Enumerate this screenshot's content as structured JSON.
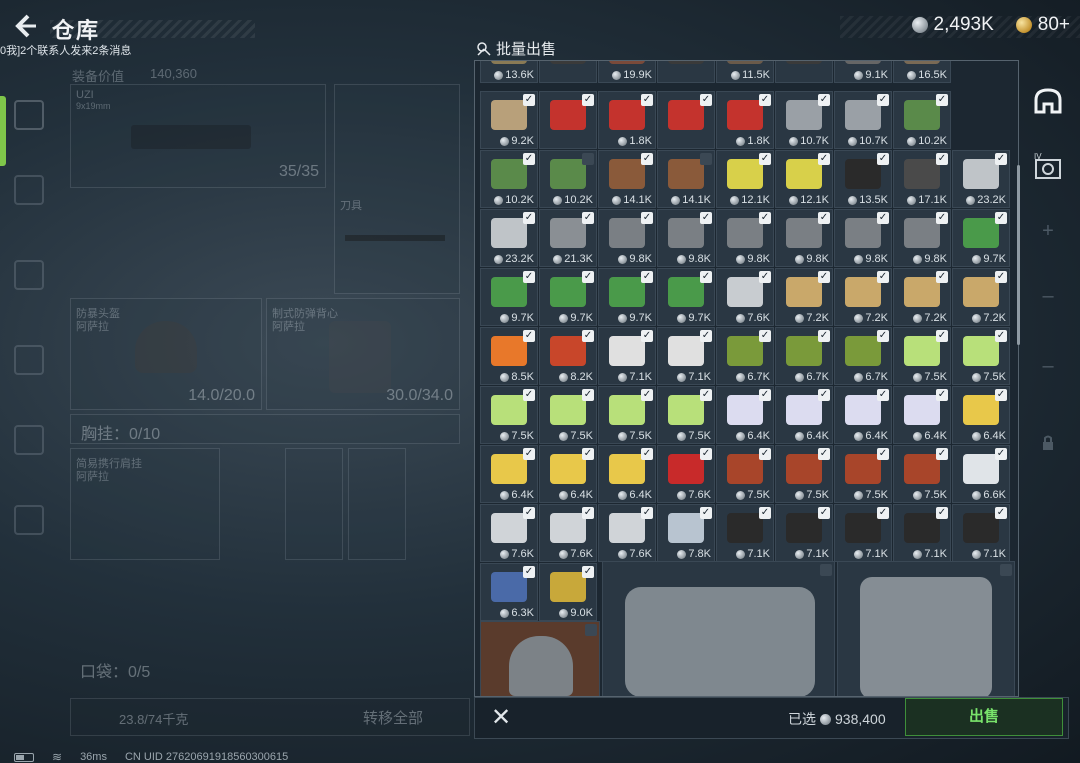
{
  "header": {
    "title": "仓库",
    "notice": "0我]2个联系人发来2条消息",
    "silver": "2,493K",
    "gold": "80+"
  },
  "loadout": {
    "equip_value_label": "装备价值",
    "equip_value": "140,360",
    "weapon_name": "UZI",
    "weapon_sub": "9x19mm",
    "weapon_ammo": "35/35",
    "melee_label": "刀具",
    "helmet_label": "防暴头盔",
    "helmet_sub": "阿萨拉",
    "helmet_durability": "14.0/20.0",
    "armor_label": "制式防弹背心",
    "armor_sub": "阿萨拉",
    "armor_durability": "30.0/34.0",
    "chest_rig": "胸挂：0/10",
    "backpack_label": "简易携行肩挂",
    "backpack_sub": "阿萨拉",
    "pouch": "口袋：0/5",
    "capacity": "23.8/74千克",
    "transfer_all": "转移全部"
  },
  "sale": {
    "title": "批量出售",
    "selected_label": "已选",
    "selected_value": "938,400",
    "sell_button": "出售"
  },
  "status": {
    "ping": "36ms",
    "uid": "CN UID 27620691918560300615"
  },
  "grid_rows": [
    {
      "prices": [
        "13.6K",
        "",
        "19.9K",
        "",
        "11.5K",
        "",
        "9.1K",
        "16.5K"
      ],
      "colors": [
        "#8a7a55",
        "#3a3a3a",
        "#7a4a3a",
        "#3a3a3a",
        "#6a5a4a",
        "#3a3a3a",
        "#666",
        "#7a6a55"
      ],
      "checks": [
        1,
        1,
        1,
        1,
        1,
        1,
        1,
        1
      ]
    },
    {
      "prices": [
        "9.2K",
        "",
        "1.8K",
        "",
        "1.8K",
        "10.7K",
        "10.7K",
        "10.2K"
      ],
      "colors": [
        "#b8a07a",
        "#c4332d",
        "#c4332d",
        "#c4332d",
        "#c4332d",
        "#9aa0a6",
        "#9aa0a6",
        "#5a8a4a"
      ],
      "checks": [
        1,
        1,
        1,
        1,
        1,
        1,
        1,
        1
      ]
    },
    {
      "prices": [
        "10.2K",
        "10.2K",
        "14.1K",
        "14.1K",
        "12.1K",
        "12.1K",
        "13.5K",
        "17.1K",
        "23.2K"
      ],
      "colors": [
        "#5a8a4a",
        "#5a8a4a",
        "#8a5a3a",
        "#8a5a3a",
        "#d8d04a",
        "#d8d04a",
        "#2a2a2a",
        "#4a4a4a",
        "#bfc4c8"
      ],
      "checks": [
        1,
        0,
        1,
        0,
        1,
        1,
        1,
        1,
        1
      ]
    },
    {
      "prices": [
        "23.2K",
        "21.3K",
        "9.8K",
        "9.8K",
        "9.8K",
        "9.8K",
        "9.8K",
        "9.8K",
        "9.7K"
      ],
      "colors": [
        "#bfc4c8",
        "#8a8f94",
        "#7a7f84",
        "#7a7f84",
        "#7a7f84",
        "#7a7f84",
        "#7a7f84",
        "#7a7f84",
        "#4a9a4a"
      ],
      "checks": [
        1,
        1,
        1,
        1,
        1,
        1,
        1,
        1,
        1
      ]
    },
    {
      "prices": [
        "9.7K",
        "9.7K",
        "9.7K",
        "9.7K",
        "7.6K",
        "7.2K",
        "7.2K",
        "7.2K",
        "7.2K"
      ],
      "colors": [
        "#4a9a4a",
        "#4a9a4a",
        "#4a9a4a",
        "#4a9a4a",
        "#c8ccd0",
        "#c9a86a",
        "#c9a86a",
        "#c9a86a",
        "#c9a86a"
      ],
      "checks": [
        1,
        1,
        1,
        1,
        1,
        1,
        1,
        1,
        1
      ]
    },
    {
      "prices": [
        "8.5K",
        "8.2K",
        "7.1K",
        "7.1K",
        "6.7K",
        "6.7K",
        "6.7K",
        "7.5K",
        "7.5K"
      ],
      "colors": [
        "#e8782a",
        "#c8462a",
        "#e0e0e0",
        "#e0e0e0",
        "#7a9a3a",
        "#7a9a3a",
        "#7a9a3a",
        "#b8e07a",
        "#b8e07a"
      ],
      "checks": [
        1,
        1,
        1,
        1,
        1,
        1,
        1,
        1,
        1
      ]
    },
    {
      "prices": [
        "7.5K",
        "7.5K",
        "7.5K",
        "7.5K",
        "6.4K",
        "6.4K",
        "6.4K",
        "6.4K",
        "6.4K"
      ],
      "colors": [
        "#b8e07a",
        "#b8e07a",
        "#b8e07a",
        "#b8e07a",
        "#dcdcf0",
        "#dcdcf0",
        "#dcdcf0",
        "#dcdcf0",
        "#e8c84a"
      ],
      "checks": [
        1,
        1,
        1,
        1,
        1,
        1,
        1,
        1,
        1
      ]
    },
    {
      "prices": [
        "6.4K",
        "6.4K",
        "6.4K",
        "7.6K",
        "7.5K",
        "7.5K",
        "7.5K",
        "7.5K",
        "6.6K"
      ],
      "colors": [
        "#e8c84a",
        "#e8c84a",
        "#e8c84a",
        "#c82a2a",
        "#a8452a",
        "#a8452a",
        "#a8452a",
        "#a8452a",
        "#e0e4e8"
      ],
      "checks": [
        1,
        1,
        1,
        1,
        1,
        1,
        1,
        1,
        1
      ]
    },
    {
      "prices": [
        "7.6K",
        "7.6K",
        "7.6K",
        "7.8K",
        "7.1K",
        "7.1K",
        "7.1K",
        "7.1K",
        "7.1K"
      ],
      "colors": [
        "#d0d4d8",
        "#d0d4d8",
        "#d0d4d8",
        "#b8c4d0",
        "#2a2a2a",
        "#2a2a2a",
        "#2a2a2a",
        "#2a2a2a",
        "#2a2a2a"
      ],
      "checks": [
        1,
        1,
        1,
        1,
        1,
        1,
        1,
        1,
        1
      ]
    },
    {
      "prices": [
        "6.3K",
        "9.0K"
      ],
      "colors": [
        "#4a6aa8",
        "#c8a83a"
      ],
      "checks": [
        1,
        1
      ]
    }
  ]
}
